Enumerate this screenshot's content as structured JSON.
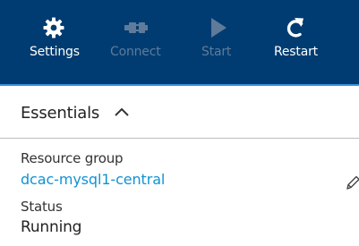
{
  "toolbar": {
    "buttons": [
      {
        "label": "Settings",
        "icon": "gear-icon",
        "enabled": true
      },
      {
        "label": "Connect",
        "icon": "connect-icon",
        "enabled": false
      },
      {
        "label": "Start",
        "icon": "play-icon",
        "enabled": false
      },
      {
        "label": "Restart",
        "icon": "restart-icon",
        "enabled": true
      }
    ],
    "background": "#003c71",
    "accent": "#3b8fd6"
  },
  "essentials": {
    "title": "Essentials",
    "icon": "chevron-up-icon",
    "properties": {
      "resource_group_label": "Resource group",
      "resource_group_value": "dcac-mysql1-central",
      "status_label": "Status",
      "status_value": "Running"
    },
    "link_color": "#1192d2",
    "edit_icon": "pencil-icon"
  }
}
